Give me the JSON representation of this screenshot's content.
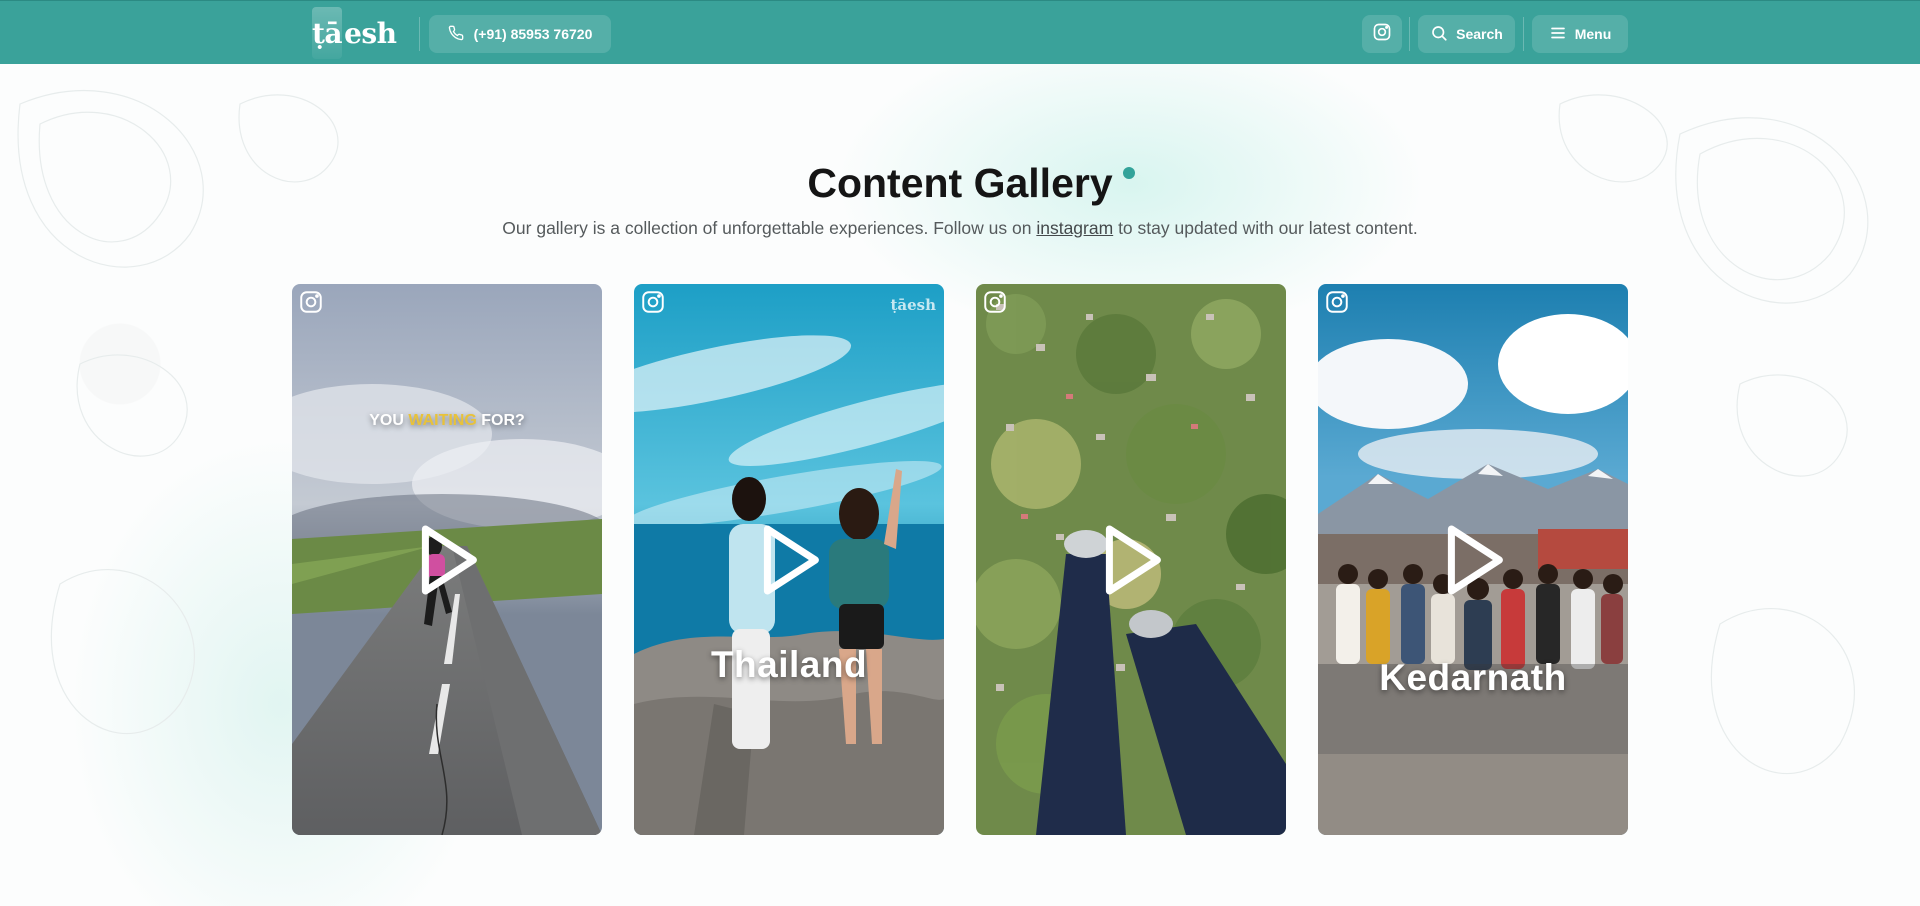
{
  "header": {
    "logo_text": "esh",
    "logo_mark": "ṭā",
    "phone_label": "(+91) 85953 76720",
    "search_label": "Search",
    "menu_label": "Menu",
    "icons": {
      "phone": "phone-icon",
      "instagram": "instagram-icon",
      "search": "search-icon",
      "menu": "hamburger-menu-icon"
    }
  },
  "gallery": {
    "title": "Content Gallery",
    "subtitle_before": "Our gallery is a collection of unforgettable experiences. Follow us on",
    "subtitle_link": "instagram",
    "subtitle_after": "to stay updated with our latest content.",
    "cards": [
      {
        "caption_pre": "YOU",
        "caption_highlight": "WAITING",
        "caption_post": "FOR?",
        "label": ""
      },
      {
        "label": "Thailand",
        "watermark": "ṭāesh"
      },
      {
        "label": ""
      },
      {
        "label": "Kedarnath"
      }
    ]
  },
  "colors": {
    "brand": "#3aa29a",
    "accent_dot": "#33a39a",
    "highlight": "#e8c23a"
  }
}
